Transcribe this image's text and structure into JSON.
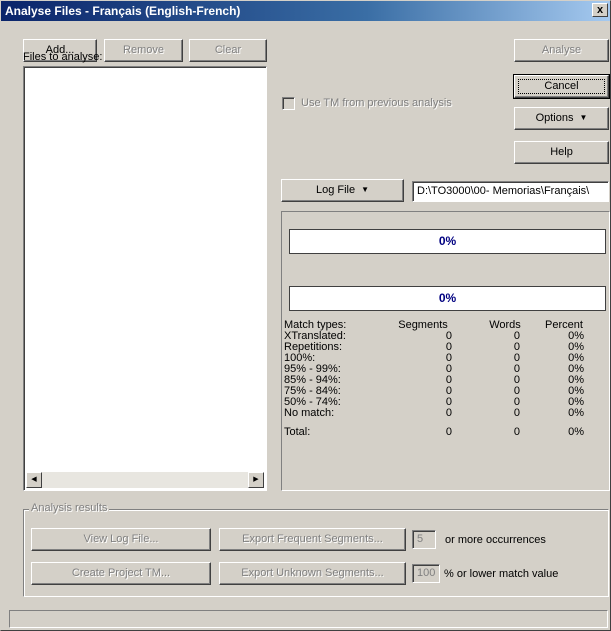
{
  "window": {
    "title": "Analyse Files - Français  (English-French)",
    "close_glyph": "x"
  },
  "toolbar": {
    "add": "Add...",
    "remove": "Remove",
    "clear": "Clear"
  },
  "files": {
    "label": "Files to analyse:",
    "items": []
  },
  "options": {
    "use_tm_label": "Use TM from previous analysis",
    "use_tm_checked": false
  },
  "right_buttons": {
    "analyse": "Analyse",
    "cancel": "Cancel",
    "options": "Options",
    "help": "Help"
  },
  "log": {
    "button": "Log File",
    "path": "D:\\TO3000\\00- Memorias\\Français\\"
  },
  "progress": {
    "file_percent": "0%",
    "total_percent": "0%",
    "file_value": 0,
    "total_value": 0
  },
  "stats": {
    "headers": [
      "Match types:",
      "Segments",
      "Words",
      "Percent"
    ],
    "rows": [
      {
        "type": "XTranslated:",
        "segments": "0",
        "words": "0",
        "percent": "0%"
      },
      {
        "type": "Repetitions:",
        "segments": "0",
        "words": "0",
        "percent": "0%"
      },
      {
        "type": "100%:",
        "segments": "0",
        "words": "0",
        "percent": "0%"
      },
      {
        "type": "95% - 99%:",
        "segments": "0",
        "words": "0",
        "percent": "0%"
      },
      {
        "type": "85% - 94%:",
        "segments": "0",
        "words": "0",
        "percent": "0%"
      },
      {
        "type": "75% - 84%:",
        "segments": "0",
        "words": "0",
        "percent": "0%"
      },
      {
        "type": "50% - 74%:",
        "segments": "0",
        "words": "0",
        "percent": "0%"
      },
      {
        "type": "No match:",
        "segments": "0",
        "words": "0",
        "percent": "0%"
      }
    ],
    "total": {
      "type": "Total:",
      "segments": "0",
      "words": "0",
      "percent": "0%"
    }
  },
  "results": {
    "group_title": "Analysis results",
    "view_log": "View Log File...",
    "create_project_tm": "Create Project TM...",
    "export_frequent": "Export Frequent Segments...",
    "export_unknown": "Export Unknown Segments...",
    "frequent_value": "5",
    "frequent_suffix": "or more occurrences",
    "unknown_value": "100",
    "unknown_suffix": "% or lower match value"
  },
  "status": {
    "text": ""
  }
}
